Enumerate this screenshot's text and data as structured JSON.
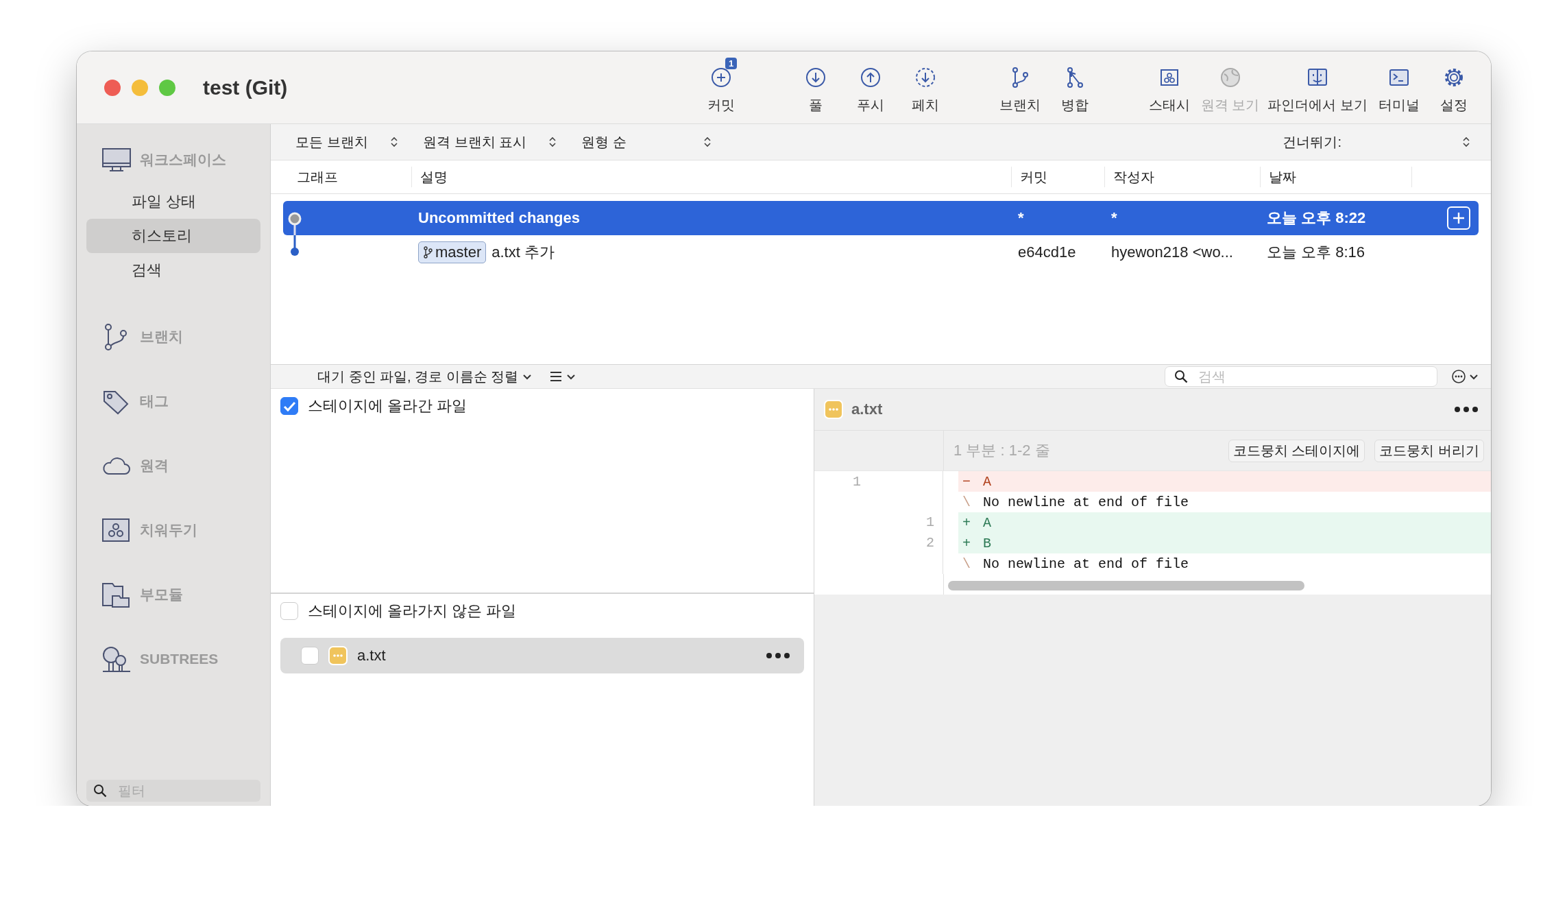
{
  "window": {
    "title": "test (Git)"
  },
  "toolbar_groups": [
    [
      {
        "kind": "commit",
        "label": "커밋",
        "badge": "1",
        "disabled": false
      }
    ],
    [
      {
        "kind": "pull",
        "label": "풀",
        "disabled": false
      },
      {
        "kind": "push",
        "label": "푸시",
        "disabled": false
      },
      {
        "kind": "fetch",
        "label": "페치",
        "disabled": false
      }
    ],
    [
      {
        "kind": "branch",
        "label": "브랜치",
        "disabled": false
      },
      {
        "kind": "merge",
        "label": "병합",
        "disabled": false
      }
    ],
    [
      {
        "kind": "stash",
        "label": "스태시",
        "disabled": false
      },
      {
        "kind": "remote",
        "label": "원격 보기",
        "disabled": true
      },
      {
        "kind": "finder",
        "label": "파인더에서 보기",
        "disabled": false
      },
      {
        "kind": "terminal",
        "label": "터미널",
        "disabled": false
      },
      {
        "kind": "settings",
        "label": "설정",
        "disabled": false
      }
    ]
  ],
  "sidebar": {
    "sections": [
      {
        "kind": "workspace",
        "label": "워크스페이스",
        "children": [
          {
            "label": "파일 상태",
            "selected": false
          },
          {
            "label": "히스토리",
            "selected": true
          },
          {
            "label": "검색",
            "selected": false
          }
        ]
      },
      {
        "kind": "branch",
        "label": "브랜치"
      },
      {
        "kind": "tag",
        "label": "태그"
      },
      {
        "kind": "remote",
        "label": "원격"
      },
      {
        "kind": "stash",
        "label": "치워두기"
      },
      {
        "kind": "submodule",
        "label": "부모듈"
      },
      {
        "kind": "subtree",
        "label": "SUBTREES"
      }
    ],
    "filter": {
      "placeholder": "필터"
    }
  },
  "history": {
    "filters": [
      {
        "label": "모든 브랜치"
      },
      {
        "label": "원격 브랜치 표시"
      },
      {
        "label": "원형 순"
      }
    ],
    "jump_label": "건너뛰기:",
    "columns": [
      "그래프",
      "설명",
      "커밋",
      "작성자",
      "날짜"
    ],
    "rows": [
      {
        "kind": "uncommitted",
        "selected": true,
        "description": "Uncommitted changes",
        "commit": "*",
        "author": "*",
        "date": "오늘 오후 8:22"
      },
      {
        "kind": "commit",
        "selected": false,
        "branch": "master",
        "description": "a.txt 추가",
        "commit": "e64cd1e",
        "author": "hyewon218 <wo...",
        "date": "오늘 오후 8:16"
      }
    ]
  },
  "files_bar": {
    "sort_label": "대기 중인 파일, 경로 이름순 정렬",
    "search": {
      "placeholder": "검색"
    }
  },
  "staged": {
    "label": "스테이지에 올라간 파일",
    "checked": true
  },
  "unstaged": {
    "label": "스테이지에 올라가지 않은 파일",
    "checked": false,
    "files": [
      {
        "name": "a.txt",
        "checked": false
      }
    ]
  },
  "diff": {
    "file": "a.txt",
    "hunk": {
      "title": "1 부분 : 1-2 줄",
      "buttons": [
        "코드뭉치 스테이지에",
        "코드뭉치 버리기"
      ]
    },
    "lines": [
      {
        "kind": "del",
        "old": "1",
        "sign": "−",
        "text": "A"
      },
      {
        "kind": "note",
        "sign": "\\",
        "text": "No newline at end of file"
      },
      {
        "kind": "add",
        "new": "1",
        "sign": "+",
        "text": "A"
      },
      {
        "kind": "add",
        "new": "2",
        "sign": "+",
        "text": "B"
      },
      {
        "kind": "note",
        "sign": "\\",
        "text": "No newline at end of file"
      }
    ]
  }
}
